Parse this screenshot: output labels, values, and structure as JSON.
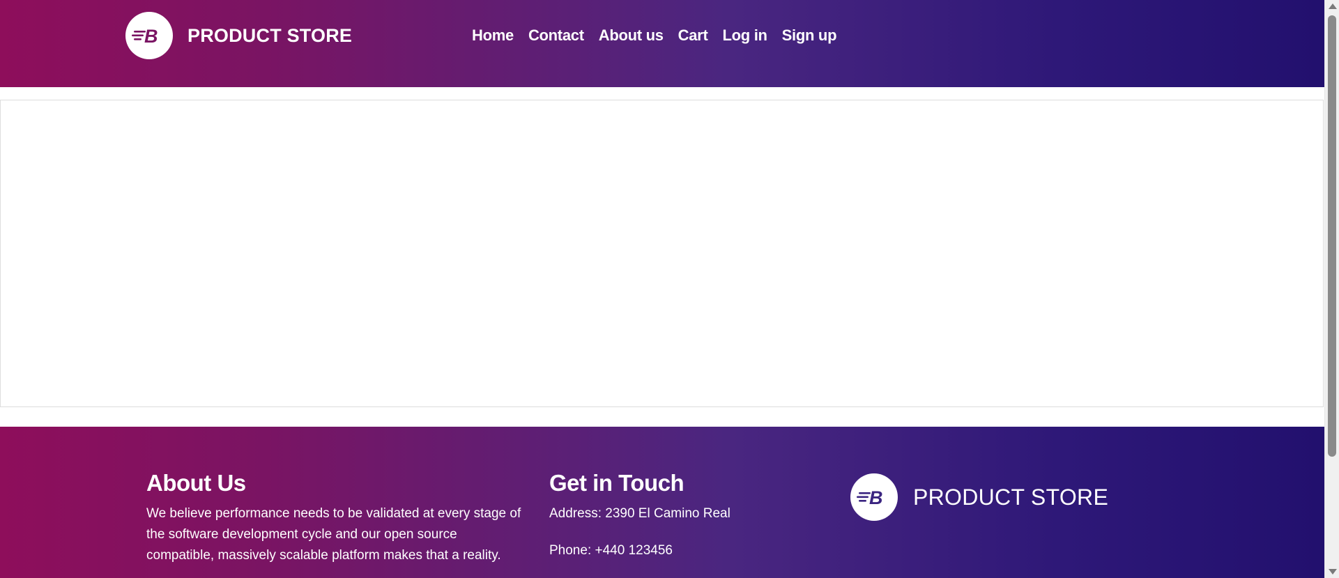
{
  "header": {
    "brand_name": "PRODUCT STORE",
    "logo_icon": "blazedemo-b-icon",
    "nav": [
      {
        "label": "Home"
      },
      {
        "label": "Contact"
      },
      {
        "label": "About us"
      },
      {
        "label": "Cart"
      },
      {
        "label": "Log in"
      },
      {
        "label": "Sign up"
      }
    ]
  },
  "footer": {
    "about": {
      "heading": "About Us",
      "text": "We believe performance needs to be validated at every stage of the software development cycle and our open source compatible, massively scalable platform makes that a reality."
    },
    "contact": {
      "heading": "Get in Touch",
      "address": "Address: 2390 El Camino Real",
      "phone": "Phone: +440 123456"
    },
    "brand_name": "PRODUCT STORE"
  },
  "colors": {
    "gradient_start": "#8e0e5b",
    "gradient_end": "#22106e",
    "logo_fill": "#7a1463",
    "footer_logo_fill": "#3a2480"
  }
}
